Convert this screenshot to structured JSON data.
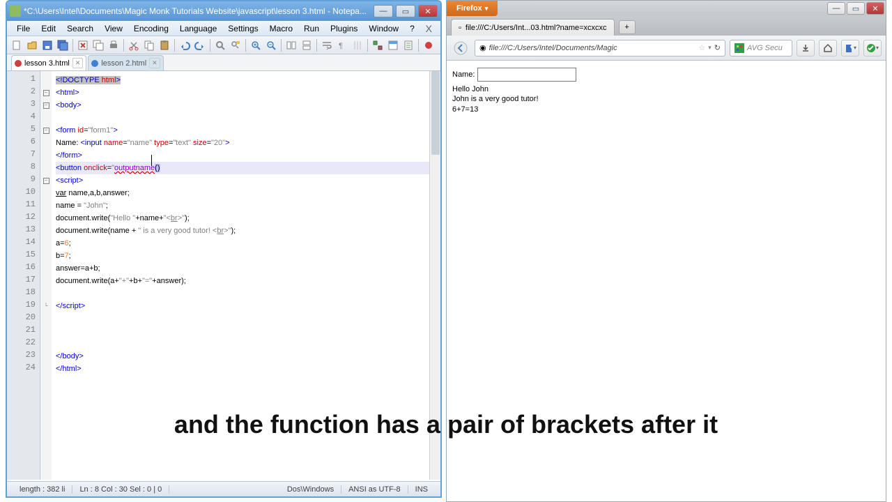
{
  "notepad": {
    "title": "*C:\\Users\\Intel\\Documents\\Magic Monk Tutorials Website\\javascript\\lesson 3.html - Notepa...",
    "menus": [
      "File",
      "Edit",
      "Search",
      "View",
      "Encoding",
      "Language",
      "Settings",
      "Macro",
      "Run",
      "Plugins",
      "Window",
      "?"
    ],
    "tabs": [
      {
        "label": "lesson 3.html"
      },
      {
        "label": "lesson 2.html"
      }
    ],
    "lines": [
      "<!DOCTYPE html>",
      "<html>",
      "<body>",
      "",
      "<form id=\"form1\">",
      "Name: <input name=\"name\" type=\"text\" size=\"20\">",
      "</form>",
      "<button onclick=\"outputname()",
      "<script>",
      "var name,a,b,answer;",
      "name = \"John\";",
      "document.write(\"Hello \"+name+\"<br>\");",
      "document.write(name + \" is a very good tutor! <br>\");",
      "a=6;",
      "b=7;",
      "answer=a+b;",
      "document.write(a+\"+\"+b+\"=\"+answer);",
      "",
      "</script>",
      "",
      "",
      "",
      "</body>",
      "</html>"
    ],
    "status": {
      "len": "length : 382   li",
      "pos": "Ln : 8    Col : 30    Sel : 0 | 0",
      "eol": "Dos\\Windows",
      "enc": "ANSI as UTF-8",
      "mode": "INS"
    }
  },
  "firefox": {
    "button": "Firefox",
    "tab_title": "file:///C:/Users/Int...03.html?name=xcxcxc",
    "url": "file:///C:/Users/Intel/Documents/Magic",
    "avg": "AVG Secu",
    "content": {
      "label": "Name:",
      "line1": "Hello John",
      "line2": "John is a very good tutor!",
      "line3": "6+7=13"
    }
  },
  "caption": "and the function has a pair of brackets after it"
}
